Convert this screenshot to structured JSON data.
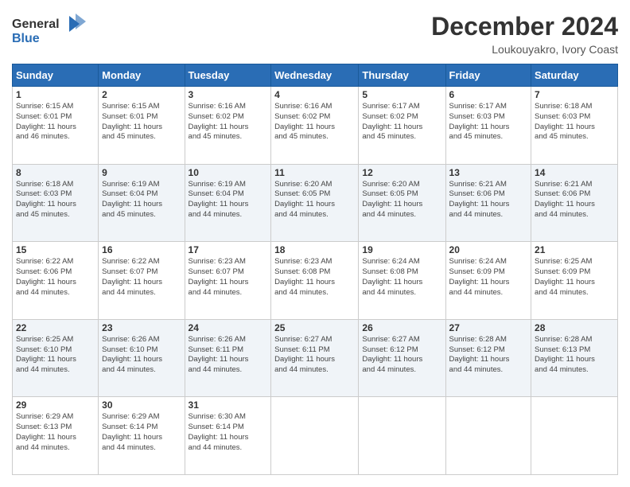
{
  "header": {
    "logo_line1": "General",
    "logo_line2": "Blue",
    "title": "December 2024",
    "subtitle": "Loukouyakro, Ivory Coast"
  },
  "calendar": {
    "days_of_week": [
      "Sunday",
      "Monday",
      "Tuesday",
      "Wednesday",
      "Thursday",
      "Friday",
      "Saturday"
    ],
    "weeks": [
      [
        {
          "day": "1",
          "info": "Sunrise: 6:15 AM\nSunset: 6:01 PM\nDaylight: 11 hours\nand 46 minutes."
        },
        {
          "day": "2",
          "info": "Sunrise: 6:15 AM\nSunset: 6:01 PM\nDaylight: 11 hours\nand 45 minutes."
        },
        {
          "day": "3",
          "info": "Sunrise: 6:16 AM\nSunset: 6:02 PM\nDaylight: 11 hours\nand 45 minutes."
        },
        {
          "day": "4",
          "info": "Sunrise: 6:16 AM\nSunset: 6:02 PM\nDaylight: 11 hours\nand 45 minutes."
        },
        {
          "day": "5",
          "info": "Sunrise: 6:17 AM\nSunset: 6:02 PM\nDaylight: 11 hours\nand 45 minutes."
        },
        {
          "day": "6",
          "info": "Sunrise: 6:17 AM\nSunset: 6:03 PM\nDaylight: 11 hours\nand 45 minutes."
        },
        {
          "day": "7",
          "info": "Sunrise: 6:18 AM\nSunset: 6:03 PM\nDaylight: 11 hours\nand 45 minutes."
        }
      ],
      [
        {
          "day": "8",
          "info": "Sunrise: 6:18 AM\nSunset: 6:03 PM\nDaylight: 11 hours\nand 45 minutes."
        },
        {
          "day": "9",
          "info": "Sunrise: 6:19 AM\nSunset: 6:04 PM\nDaylight: 11 hours\nand 45 minutes."
        },
        {
          "day": "10",
          "info": "Sunrise: 6:19 AM\nSunset: 6:04 PM\nDaylight: 11 hours\nand 44 minutes."
        },
        {
          "day": "11",
          "info": "Sunrise: 6:20 AM\nSunset: 6:05 PM\nDaylight: 11 hours\nand 44 minutes."
        },
        {
          "day": "12",
          "info": "Sunrise: 6:20 AM\nSunset: 6:05 PM\nDaylight: 11 hours\nand 44 minutes."
        },
        {
          "day": "13",
          "info": "Sunrise: 6:21 AM\nSunset: 6:06 PM\nDaylight: 11 hours\nand 44 minutes."
        },
        {
          "day": "14",
          "info": "Sunrise: 6:21 AM\nSunset: 6:06 PM\nDaylight: 11 hours\nand 44 minutes."
        }
      ],
      [
        {
          "day": "15",
          "info": "Sunrise: 6:22 AM\nSunset: 6:06 PM\nDaylight: 11 hours\nand 44 minutes."
        },
        {
          "day": "16",
          "info": "Sunrise: 6:22 AM\nSunset: 6:07 PM\nDaylight: 11 hours\nand 44 minutes."
        },
        {
          "day": "17",
          "info": "Sunrise: 6:23 AM\nSunset: 6:07 PM\nDaylight: 11 hours\nand 44 minutes."
        },
        {
          "day": "18",
          "info": "Sunrise: 6:23 AM\nSunset: 6:08 PM\nDaylight: 11 hours\nand 44 minutes."
        },
        {
          "day": "19",
          "info": "Sunrise: 6:24 AM\nSunset: 6:08 PM\nDaylight: 11 hours\nand 44 minutes."
        },
        {
          "day": "20",
          "info": "Sunrise: 6:24 AM\nSunset: 6:09 PM\nDaylight: 11 hours\nand 44 minutes."
        },
        {
          "day": "21",
          "info": "Sunrise: 6:25 AM\nSunset: 6:09 PM\nDaylight: 11 hours\nand 44 minutes."
        }
      ],
      [
        {
          "day": "22",
          "info": "Sunrise: 6:25 AM\nSunset: 6:10 PM\nDaylight: 11 hours\nand 44 minutes."
        },
        {
          "day": "23",
          "info": "Sunrise: 6:26 AM\nSunset: 6:10 PM\nDaylight: 11 hours\nand 44 minutes."
        },
        {
          "day": "24",
          "info": "Sunrise: 6:26 AM\nSunset: 6:11 PM\nDaylight: 11 hours\nand 44 minutes."
        },
        {
          "day": "25",
          "info": "Sunrise: 6:27 AM\nSunset: 6:11 PM\nDaylight: 11 hours\nand 44 minutes."
        },
        {
          "day": "26",
          "info": "Sunrise: 6:27 AM\nSunset: 6:12 PM\nDaylight: 11 hours\nand 44 minutes."
        },
        {
          "day": "27",
          "info": "Sunrise: 6:28 AM\nSunset: 6:12 PM\nDaylight: 11 hours\nand 44 minutes."
        },
        {
          "day": "28",
          "info": "Sunrise: 6:28 AM\nSunset: 6:13 PM\nDaylight: 11 hours\nand 44 minutes."
        }
      ],
      [
        {
          "day": "29",
          "info": "Sunrise: 6:29 AM\nSunset: 6:13 PM\nDaylight: 11 hours\nand 44 minutes."
        },
        {
          "day": "30",
          "info": "Sunrise: 6:29 AM\nSunset: 6:14 PM\nDaylight: 11 hours\nand 44 minutes."
        },
        {
          "day": "31",
          "info": "Sunrise: 6:30 AM\nSunset: 6:14 PM\nDaylight: 11 hours\nand 44 minutes."
        },
        {
          "day": "",
          "info": ""
        },
        {
          "day": "",
          "info": ""
        },
        {
          "day": "",
          "info": ""
        },
        {
          "day": "",
          "info": ""
        }
      ]
    ]
  }
}
